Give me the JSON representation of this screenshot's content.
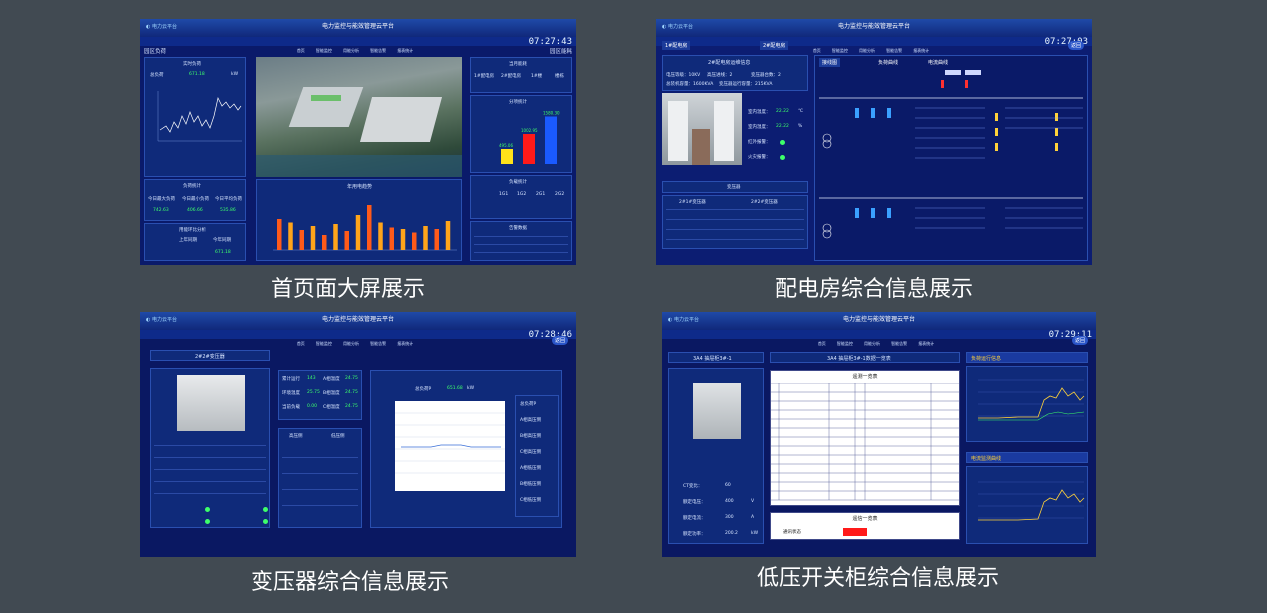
{
  "captions": {
    "home": "首页面大屏展示",
    "power_room": "配电房综合信息展示",
    "transformer": "变压器综合信息展示",
    "lowvoltage": "低压开关柜综合信息展示"
  },
  "app": {
    "title": "电力监控与能效管理云平台",
    "nav": [
      "首页",
      "智能监控",
      "用能分析",
      "智能告警",
      "报表统计"
    ]
  },
  "home": {
    "clock": "07:27:43",
    "left_title": "园区负荷",
    "right_title": "园区能耗",
    "realtime": {
      "title": "实时负荷",
      "label": "总负荷",
      "value": "671.18",
      "unit": "kW"
    },
    "load_stats": {
      "title": "负荷统计",
      "labels": [
        "今日最大负荷",
        "今日最小负荷",
        "今日平均负荷"
      ],
      "values": [
        "742.63",
        "406.66",
        "535.86"
      ]
    },
    "yoy": {
      "title": "用能环比分析",
      "cols": [
        "上年同期",
        "今年同期"
      ],
      "value": "671.18"
    },
    "monthly": {
      "title": "当月能耗",
      "rooms": [
        "1#配电房",
        "2#配电房",
        "1#楼",
        "楼栋"
      ]
    },
    "split": {
      "title": "分项统计",
      "bars": [
        {
          "label": "495.06",
          "v": 30
        },
        {
          "label": "1002.95",
          "v": 60
        },
        {
          "label": "1580.30",
          "v": 95
        }
      ]
    },
    "load_counts": {
      "title": "负载统计",
      "cols": [
        "1G1",
        "1G2",
        "2G1",
        "2G2"
      ]
    },
    "alarms": {
      "title": "告警数据"
    },
    "year_trend": {
      "title": "年用电趋势",
      "values": [
        62,
        55,
        40,
        48,
        30,
        52,
        38,
        70,
        90,
        55,
        45,
        42,
        35,
        48,
        42,
        58
      ]
    }
  },
  "room": {
    "clock": "07:27:03",
    "tabs": [
      "1#配电房",
      "2#配电房"
    ],
    "back": "返回",
    "info_title": "2#配电房运维信息",
    "info": [
      "电压等级：10KV",
      "高压进线：2",
      "变压器台数：2",
      "总装机容量：1600KVA",
      "变压器运行容量：215KVA"
    ],
    "env": [
      {
        "label": "室内温度：",
        "value": "22.22",
        "unit": "℃"
      },
      {
        "label": "室内湿度：",
        "value": "22.22",
        "unit": "%"
      },
      {
        "label": "红外报警：",
        "value": "",
        "unit": ""
      },
      {
        "label": "火灾报警：",
        "value": "",
        "unit": ""
      }
    ],
    "transformer_title": "变压器",
    "tr_cols": [
      "2#1#变压器",
      "2#2#变压器"
    ],
    "tabs_right": [
      "接线图",
      "负荷曲线",
      "电流曲线"
    ]
  },
  "trans": {
    "clock": "07:28:46",
    "back": "返回",
    "title": "2#2#变压器",
    "stats": [
      {
        "label": "累计运行",
        "value": "143"
      },
      {
        "label": "环境温度",
        "value": "25.75"
      },
      {
        "label": "当前负载",
        "value": "0.00"
      }
    ],
    "phase_temps": [
      {
        "label": "A相温度",
        "value": "24.75"
      },
      {
        "label": "B相温度",
        "value": "24.75"
      },
      {
        "label": "C相温度",
        "value": "24.75"
      }
    ],
    "hv_title": "高压侧",
    "lv_title": "低压侧",
    "chart_title": "总负荷P",
    "chart_value": "651.68",
    "chart_unit": "kW",
    "legend": [
      "总负荷P",
      "A相高压侧",
      "B相高压侧",
      "C相高压侧",
      "A相低压侧",
      "B相低压侧",
      "C相低压侧"
    ]
  },
  "lowv": {
    "clock": "07:29:11",
    "back": "返回",
    "cabinet": "3A4 抽屉柜3#-1",
    "data_title": "3A4 抽屉柜3#-1数据一览表",
    "measure_title": "遥测一览表",
    "signal_title": "遥信一览表",
    "signal_row": "通讯状态",
    "right_titles": [
      "负荷运行信息",
      "电流监测曲线"
    ],
    "ct": [
      {
        "label": "CT变比：",
        "value": "60",
        "unit": ""
      },
      {
        "label": "额定电压：",
        "value": "400",
        "unit": "V"
      },
      {
        "label": "额定电流：",
        "value": "300",
        "unit": "A"
      },
      {
        "label": "额定功率：",
        "value": "200.2",
        "unit": "kW"
      }
    ]
  }
}
